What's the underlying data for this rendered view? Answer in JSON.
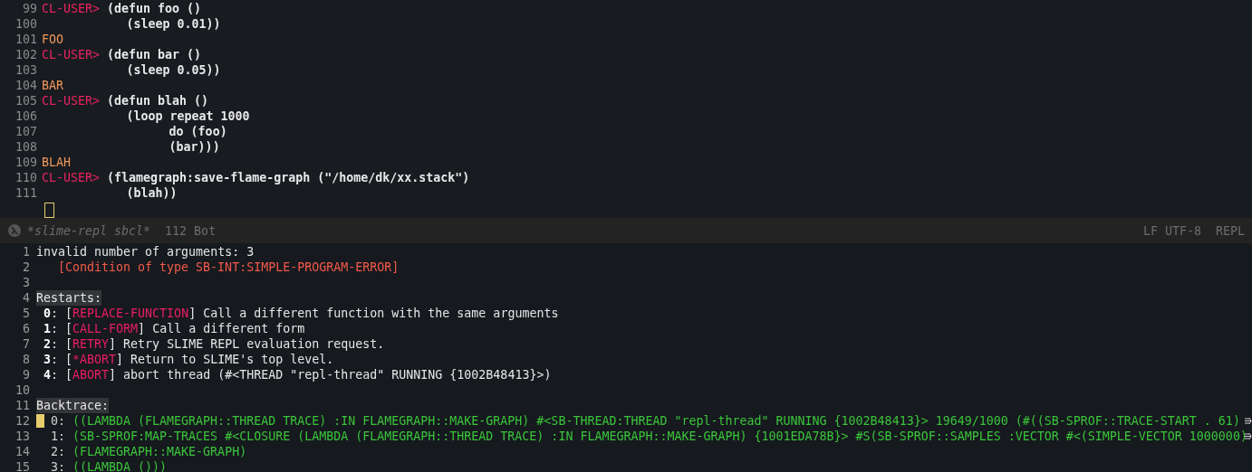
{
  "repl_pane": {
    "lines": [
      {
        "number": "99",
        "kind": "prompt",
        "prompt": "CL-USER>",
        "code": "(defun foo ()"
      },
      {
        "number": "100",
        "kind": "code",
        "code": "          (sleep 0.01))"
      },
      {
        "number": "101",
        "kind": "result",
        "code": "FOO"
      },
      {
        "number": "102",
        "kind": "prompt",
        "prompt": "CL-USER>",
        "code": "(defun bar ()"
      },
      {
        "number": "103",
        "kind": "code",
        "code": "          (sleep 0.05))"
      },
      {
        "number": "104",
        "kind": "result",
        "code": "BAR"
      },
      {
        "number": "105",
        "kind": "prompt",
        "prompt": "CL-USER>",
        "code": "(defun blah ()"
      },
      {
        "number": "106",
        "kind": "code",
        "code": "          (loop repeat 1000"
      },
      {
        "number": "107",
        "kind": "code",
        "code": "                do (foo)"
      },
      {
        "number": "108",
        "kind": "code",
        "code": "                (bar)))"
      },
      {
        "number": "109",
        "kind": "result",
        "code": "BLAH"
      },
      {
        "number": "110",
        "kind": "prompt",
        "prompt": "CL-USER>",
        "code": "(flamegraph:save-flame-graph (\"/home/dk/xx.stack\")"
      },
      {
        "number": "111",
        "kind": "code",
        "code": "          (blah))"
      },
      {
        "kind": "cursor"
      }
    ]
  },
  "mode_line": {
    "buffer_name": "*slime-repl sbcl*",
    "position": "112 Bot",
    "encoding": "LF UTF-8",
    "mode": "REPL"
  },
  "debugger_pane": {
    "lines": [
      {
        "number": "1",
        "kind": "message",
        "text": "invalid number of arguments: 3"
      },
      {
        "number": "2",
        "kind": "condition",
        "text": "[Condition of type SB-INT:SIMPLE-PROGRAM-ERROR]"
      },
      {
        "number": "3",
        "kind": "blank"
      },
      {
        "number": "4",
        "kind": "heading",
        "text": "Restarts:"
      },
      {
        "number": "5",
        "kind": "restart",
        "index": "**0**:",
        "name": "[REPLACE-FUNCTION]",
        "text": "Call a different function with the same arguments"
      },
      {
        "number": "6",
        "kind": "restart",
        "index": "**1**:",
        "name": "[CALL-FORM]",
        "text": "Call a different form"
      },
      {
        "number": "7",
        "kind": "restart",
        "index": "**2**:",
        "name": "[RETRY]",
        "text": "Retry SLIME REPL evaluation request."
      },
      {
        "number": "8",
        "kind": "restart",
        "index": "**3**:",
        "name": "[*ABORT]",
        "text": "Return to SLIME's top level."
      },
      {
        "number": "9",
        "kind": "restart",
        "index": "**4**:",
        "name": "[ABORT]",
        "text": "abort thread (#<THREAD \"repl-thread\" RUNNING {1002B48413}>)"
      },
      {
        "number": "10",
        "kind": "blank"
      },
      {
        "number": "11",
        "kind": "heading",
        "text": "Backtrace:"
      },
      {
        "number": "12",
        "kind": "frame",
        "cursor": true,
        "truncated": true,
        "index": "0:",
        "text": "((LAMBDA (FLAMEGRAPH::THREAD TRACE) :IN FLAMEGRAPH::MAKE-GRAPH) #<SB-THREAD:THREAD \"repl-thread\" RUNNING {1002B48413}> 19649/1000 (#((SB-SPROF::TRACE-START . 61)"
      },
      {
        "number": "13",
        "kind": "frame",
        "cursor": false,
        "truncated": true,
        "index": "1:",
        "text": "(SB-SPROF:MAP-TRACES #<CLOSURE (LAMBDA (FLAMEGRAPH::THREAD TRACE) :IN FLAMEGRAPH::MAKE-GRAPH) {1001EDA78B}> #S(SB-SPROF::SAMPLES :VECTOR #<(SIMPLE-VECTOR 1000000)"
      },
      {
        "number": "14",
        "kind": "frame",
        "cursor": false,
        "truncated": false,
        "index": "2:",
        "text": "(FLAMEGRAPH::MAKE-GRAPH)"
      },
      {
        "number": "15",
        "kind": "frame",
        "cursor": false,
        "truncated": false,
        "index": "3:",
        "text": "((LAMBDA ()))"
      }
    ]
  }
}
